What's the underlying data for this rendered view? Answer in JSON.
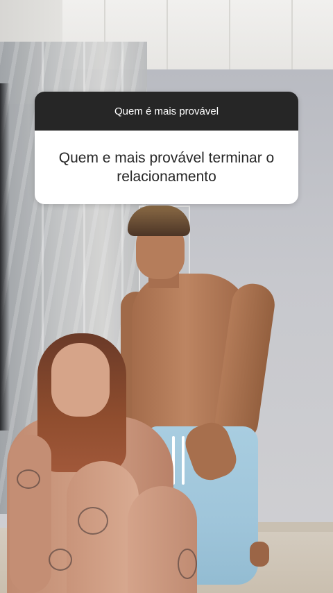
{
  "story": {
    "question_sticker": {
      "header": "Quem é mais provável",
      "answer": "Quem e mais provável terminar o relacionamento",
      "header_bg": "#262626",
      "body_bg": "#ffffff"
    }
  }
}
